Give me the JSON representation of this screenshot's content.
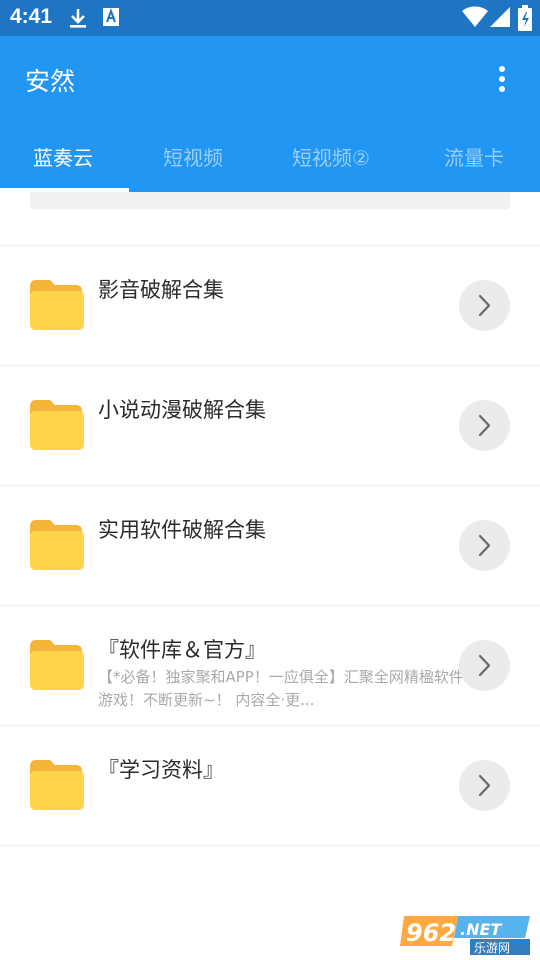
{
  "status_bar": {
    "time": "4:41",
    "left_icons": [
      "download-icon",
      "app-notification-icon"
    ],
    "right_icons": [
      "wifi-icon",
      "signal-icon",
      "battery-icon"
    ]
  },
  "app_bar": {
    "title": "安然",
    "menu_icon": "more-vert-icon",
    "background_color": "#2196f3",
    "status_bar_color": "#1e75c4"
  },
  "tabs": [
    {
      "label": "蓝奏云",
      "active": true
    },
    {
      "label": "短视频",
      "active": false
    },
    {
      "label": "短视频②",
      "active": false
    },
    {
      "label": "流量卡",
      "active": false
    }
  ],
  "folders": [
    {
      "title": "影音破解合集",
      "description": ""
    },
    {
      "title": "小说动漫破解合集",
      "description": ""
    },
    {
      "title": "实用软件破解合集",
      "description": ""
    },
    {
      "title": "『软件库＆官方』",
      "description": "【*必备！独家聚和APP！一应俱全】汇聚全网精楹软件 游戏！不断更新~！ 内容全·更..."
    },
    {
      "title": "『学习资料』",
      "description": ""
    }
  ],
  "folder_icon": "folder-icon",
  "row_action_icon": "chevron-right-icon",
  "folder_color": "#ffd44a",
  "watermark": {
    "brand": "962.NET",
    "sub": "乐游网"
  }
}
